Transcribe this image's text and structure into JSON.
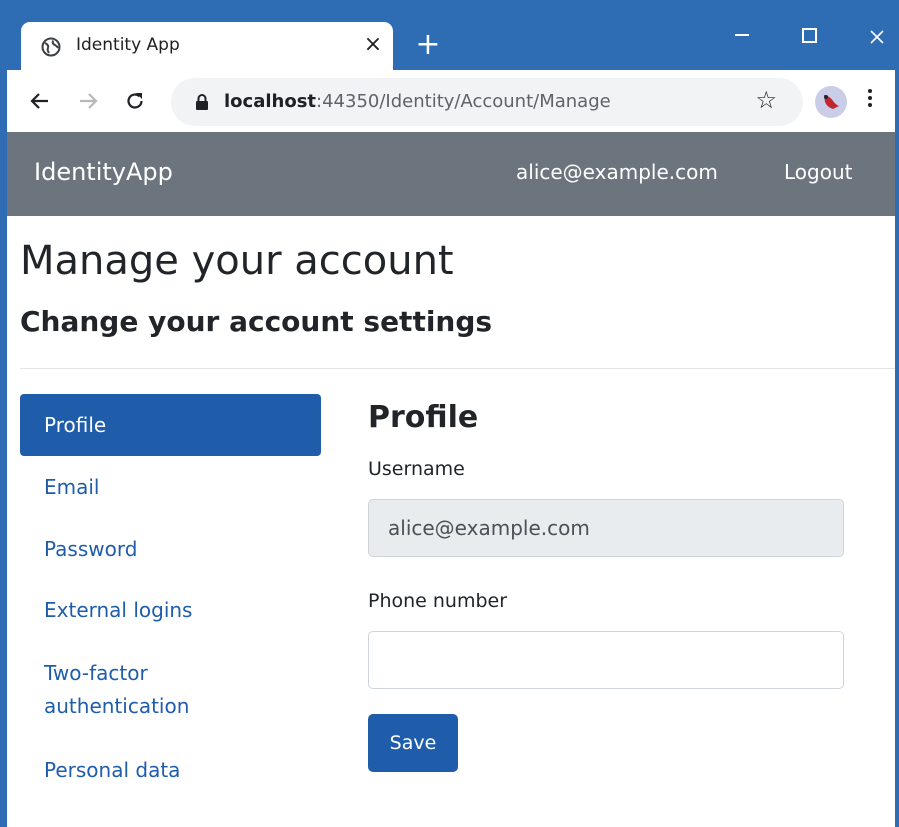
{
  "browser": {
    "tab_title": "Identity App",
    "tab_close": "×",
    "new_tab": "+",
    "url_host": "localhost",
    "url_rest": ":44350/Identity/Account/Manage",
    "icons": {
      "favicon": "globe-icon",
      "back": "back-arrow-icon",
      "forward": "forward-arrow-icon",
      "reload": "reload-icon",
      "lock": "lock-icon",
      "bookmark": "star-icon",
      "profile": "profile-avatar-icon",
      "menu": "kebab-menu-icon"
    }
  },
  "navbar": {
    "brand": "IdentityApp",
    "user": "alice@example.com",
    "logout": "Logout"
  },
  "page": {
    "title": "Manage your account",
    "subtitle": "Change your account settings"
  },
  "sidebar": {
    "items": [
      {
        "label": "Profile",
        "active": true
      },
      {
        "label": "Email",
        "active": false
      },
      {
        "label": "Password",
        "active": false
      },
      {
        "label": "External logins",
        "active": false
      },
      {
        "label": "Two-factor authentication",
        "active": false
      },
      {
        "label": "Personal data",
        "active": false
      }
    ]
  },
  "profile": {
    "heading": "Profile",
    "username_label": "Username",
    "username_value": "alice@example.com",
    "phone_label": "Phone number",
    "phone_value": "",
    "save_label": "Save"
  },
  "colors": {
    "chrome": "#2e6db4",
    "navbar": "#6c757d",
    "primary": "#1f5dab"
  }
}
